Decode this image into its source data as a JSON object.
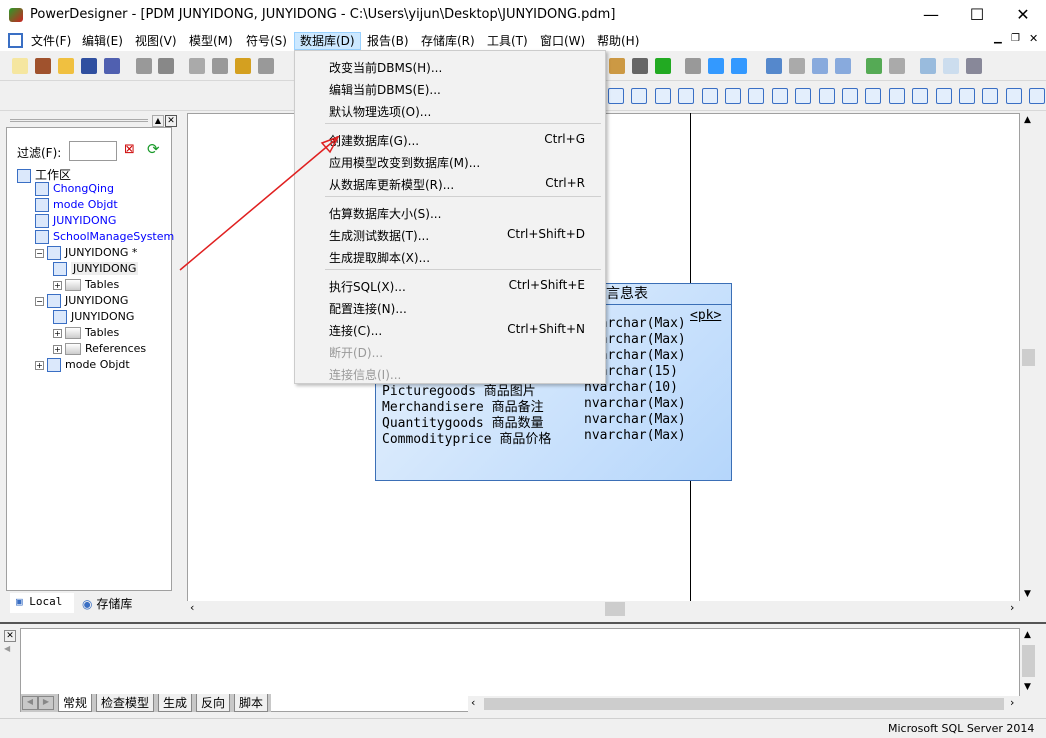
{
  "window": {
    "title": "PowerDesigner - [PDM JUNYIDONG, JUNYIDONG - C:\\Users\\yijun\\Desktop\\JUNYIDONG.pdm]",
    "minimize": "—",
    "maximize": "☐",
    "close": "✕"
  },
  "menubar": [
    "文件(F)",
    "编辑(E)",
    "视图(V)",
    "模型(M)",
    "符号(S)",
    "数据库(D)",
    "报告(B)",
    "存储库(R)",
    "工具(T)",
    "窗口(W)",
    "帮助(H)"
  ],
  "menubar_active": "数据库(D)",
  "dropdown": [
    {
      "label": "改变当前DBMS(H)...",
      "shortcut": ""
    },
    {
      "label": "编辑当前DBMS(E)...",
      "shortcut": ""
    },
    {
      "label": "默认物理选项(O)...",
      "shortcut": ""
    },
    {
      "label": "创建数据库(G)...",
      "shortcut": "Ctrl+G"
    },
    {
      "label": "应用模型改变到数据库(M)...",
      "shortcut": ""
    },
    {
      "label": "从数据库更新模型(R)...",
      "shortcut": "Ctrl+R"
    },
    {
      "label": "估算数据库大小(S)...",
      "shortcut": ""
    },
    {
      "label": "生成测试数据(T)...",
      "shortcut": "Ctrl+Shift+D"
    },
    {
      "label": "生成提取脚本(X)...",
      "shortcut": ""
    },
    {
      "label": "执行SQL(X)...",
      "shortcut": "Ctrl+Shift+E"
    },
    {
      "label": "配置连接(N)...",
      "shortcut": ""
    },
    {
      "label": "连接(C)...",
      "shortcut": "Ctrl+Shift+N"
    },
    {
      "label": "断开(D)...",
      "shortcut": "",
      "disabled": true
    },
    {
      "label": "连接信息(I)...",
      "shortcut": "",
      "disabled": true
    }
  ],
  "browser": {
    "filter_label": "过滤(F):",
    "filter_value": "",
    "tree": [
      {
        "label": "工作区",
        "level": 0
      },
      {
        "label": "ChongQing",
        "level": 1,
        "blue": true
      },
      {
        "label": "mode Objdt",
        "level": 1,
        "blue": true
      },
      {
        "label": "JUNYIDONG",
        "level": 1,
        "blue": true
      },
      {
        "label": "SchoolManageSystem",
        "level": 1,
        "blue": true
      },
      {
        "label": "JUNYIDONG *",
        "level": 1,
        "expanded": true
      },
      {
        "label": "JUNYIDONG",
        "level": 2,
        "selected": true
      },
      {
        "label": "Tables",
        "level": 2,
        "folder": true
      },
      {
        "label": "JUNYIDONG",
        "level": 1,
        "expanded": true
      },
      {
        "label": "JUNYIDONG",
        "level": 2
      },
      {
        "label": "Tables",
        "level": 2,
        "folder": true
      },
      {
        "label": "References",
        "level": 2,
        "folder": true
      },
      {
        "label": "mode Objdt",
        "level": 1
      }
    ],
    "tabs": [
      "Local",
      "存储库"
    ]
  },
  "diagram_table": {
    "title": "言息表",
    "pk": "<pk>",
    "rows": [
      {
        "name": "",
        "type": "nvarchar(Max)"
      },
      {
        "name": "",
        "type": "nvarchar(Max)"
      },
      {
        "name": "",
        "type": "nvarchar(Max)"
      },
      {
        "name": "",
        "type": "nvarchar(15)"
      },
      {
        "name": "Picturegoods 商品图片",
        "type": "nvarchar(10)"
      },
      {
        "name": "Merchandisere 商品备注",
        "type": "nvarchar(Max)"
      },
      {
        "name": "Quantitygoods 商品数量",
        "type": "nvarchar(Max)"
      },
      {
        "name": "Commodityprice 商品价格",
        "type": "nvarchar(Max)"
      }
    ]
  },
  "output_tabs": [
    "常规",
    "检查模型",
    "生成",
    "反向",
    "脚本"
  ],
  "status": "Microsoft SQL Server 2014",
  "colors": {
    "menu_highlight": "#cce8ff",
    "table_fill": "#b5d6fb",
    "arrow": "#e02020"
  }
}
